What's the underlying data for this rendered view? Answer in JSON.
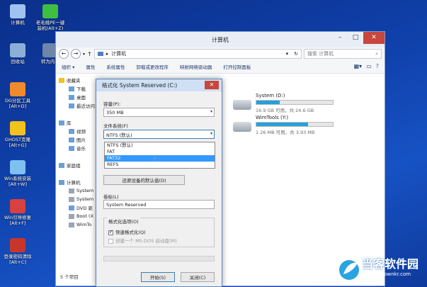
{
  "desktop": {
    "icons": [
      {
        "label": "计算机",
        "icon": "computer-icon"
      },
      {
        "label": "回收站",
        "icon": "recycle-bin-icon"
      },
      {
        "label": "DG分区工具\n[Alt+D]",
        "icon": "dg-partition-icon"
      },
      {
        "label": "GHOST克隆\n[Alt+G]",
        "icon": "ghost-icon"
      },
      {
        "label": "Win系统安装\n[Alt+W]",
        "icon": "win-install-icon"
      },
      {
        "label": "Win引导修复\n[Alt+F]",
        "icon": "boot-repair-icon"
      },
      {
        "label": "登录密码清除\n[Alt+C]",
        "icon": "password-clear-icon"
      }
    ],
    "icons2": [
      {
        "label": "老毛桃PE一键\n装机(Alt+Z)",
        "icon": "laomaotao-icon"
      },
      {
        "label": "转为内存",
        "icon": "ram-icon"
      }
    ]
  },
  "explorer": {
    "title": "计算机",
    "address": "计算机",
    "search_placeholder": "搜索 计算机",
    "toolbar": [
      "组织 ▾",
      "属性",
      "系统属性",
      "卸载或更改程序",
      "映射网络驱动器",
      "打开控制面板"
    ],
    "nav": [
      {
        "label": "收藏夹",
        "icon": "star-icon",
        "indent": 0
      },
      {
        "label": "下载",
        "icon": "folder-icon",
        "indent": 1
      },
      {
        "label": "桌面",
        "icon": "desktop-icon",
        "indent": 1
      },
      {
        "label": "最近访问",
        "icon": "recent-icon",
        "indent": 1
      },
      {
        "label": "",
        "icon": "",
        "indent": 0
      },
      {
        "label": "库",
        "icon": "library-icon",
        "indent": 0
      },
      {
        "label": "视频",
        "icon": "video-icon",
        "indent": 1
      },
      {
        "label": "图片",
        "icon": "picture-icon",
        "indent": 1
      },
      {
        "label": "音乐",
        "icon": "music-icon",
        "indent": 1
      },
      {
        "label": "",
        "icon": "",
        "indent": 0
      },
      {
        "label": "家庭组",
        "icon": "homegroup-icon",
        "indent": 0
      },
      {
        "label": "",
        "icon": "",
        "indent": 0
      },
      {
        "label": "计算机",
        "icon": "computer-icon",
        "indent": 0
      },
      {
        "label": "System",
        "icon": "drive-icon",
        "indent": 1
      },
      {
        "label": "System",
        "icon": "drive-icon",
        "indent": 1
      },
      {
        "label": "DVD 驱",
        "icon": "dvd-icon",
        "indent": 1
      },
      {
        "label": "Boot (X",
        "icon": "drive-icon",
        "indent": 1
      },
      {
        "label": "WimTo",
        "icon": "drive-icon",
        "indent": 1
      }
    ],
    "drives": [
      {
        "name": "System (D:)",
        "info": "16.9 GB 可用，共 24.6 GB",
        "used_fraction": 0.31
      },
      {
        "name": "WimTools (Y:)",
        "info": "1.26 MB 可用，共 3.93 MB",
        "used_fraction": 0.68
      }
    ],
    "status": "5 个项目"
  },
  "dialog": {
    "title": "格式化 System Reserved (C:)",
    "capacity_label": "容量(P):",
    "capacity_value": "350 MB",
    "fs_label": "文件系统(F)",
    "fs_value": "NTFS (默认)",
    "fs_options": [
      "NTFS (默认)",
      "FAT",
      "FAT32",
      "REFS"
    ],
    "fs_selected": "FAT32",
    "restore_button": "还原设备的默认值(D)",
    "volume_label_label": "卷标(L)",
    "volume_label_value": "System Reserved",
    "options_label": "格式化选项(O)",
    "quick_format": "快速格式化(Q)",
    "msdos_disk": "创建一个 MS-DOS 启动盘(M)",
    "start_button": "开始(S)",
    "close_button": "关闭(C)"
  },
  "watermark": {
    "main": "当客软件园",
    "url": "www.downkr.com"
  }
}
